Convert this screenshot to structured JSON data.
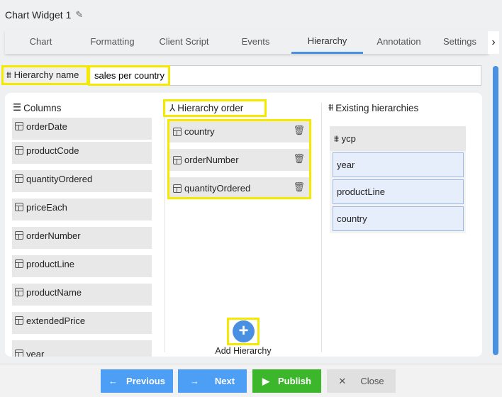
{
  "title": "Chart Widget 1",
  "tabs": [
    "Chart",
    "Formatting",
    "Client Script",
    "Events",
    "Hierarchy",
    "Annotation",
    "Settings"
  ],
  "active_tab": "Hierarchy",
  "hierarchy_name": {
    "label": "Hierarchy name",
    "value": "sales per country"
  },
  "columns": {
    "header": "Columns",
    "items": [
      "orderDate",
      "productCode",
      "quantityOrdered",
      "priceEach",
      "orderNumber",
      "productLine",
      "productName",
      "extendedPrice",
      "year"
    ]
  },
  "order": {
    "header": "Hierarchy order",
    "items": [
      "country",
      "orderNumber",
      "quantityOrdered"
    ],
    "add_label": "Add Hierarchy"
  },
  "existing": {
    "header": "Existing hierarchies",
    "name": "ycp",
    "items": [
      "year",
      "productLine",
      "country"
    ]
  },
  "footer": {
    "previous": "Previous",
    "next": "Next",
    "publish": "Publish",
    "close": "Close"
  },
  "colors": {
    "accent": "#4a90e2",
    "publish": "#3cb72b",
    "highlight": "#f5e900"
  }
}
